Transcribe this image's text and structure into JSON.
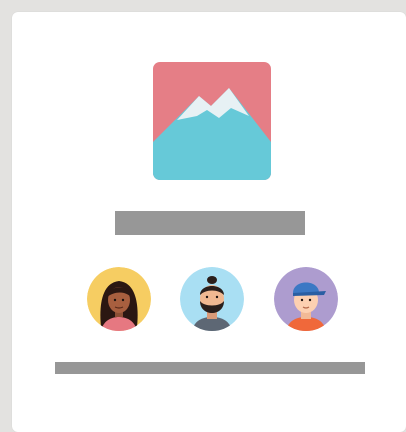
{
  "colors": {
    "page_background": "#e3e2e0",
    "card_background": "#ffffff",
    "placeholder_bar": "#979797",
    "logo_sky": "#e57e86",
    "logo_mountain": "#66c9d8",
    "logo_snow": "#e7f1f4",
    "avatar_1_background": "#f6cd62",
    "avatar_2_background": "#a9dff3",
    "avatar_3_background": "#ad9ccf"
  },
  "logo": {
    "icon": "mountain-image-icon"
  },
  "placeholders": {
    "title": "text-placeholder-bar",
    "footer": "text-placeholder-bar"
  },
  "avatars": [
    {
      "icon": "woman-avatar-icon"
    },
    {
      "icon": "bearded-man-avatar-icon"
    },
    {
      "icon": "capped-man-avatar-icon"
    }
  ]
}
